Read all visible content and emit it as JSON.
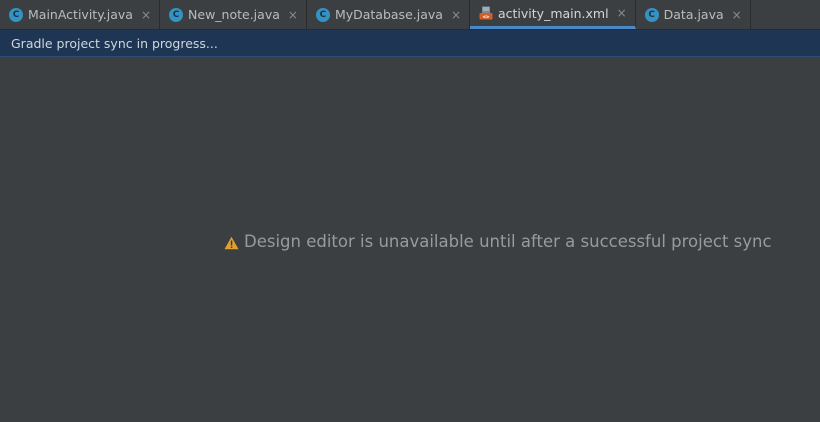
{
  "tabs": [
    {
      "label": "MainActivity.java",
      "icon": "java-class-icon",
      "active": false
    },
    {
      "label": "New_note.java",
      "icon": "java-class-icon",
      "active": false
    },
    {
      "label": "MyDatabase.java",
      "icon": "java-class-icon",
      "active": false
    },
    {
      "label": "activity_main.xml",
      "icon": "xml-layout-icon",
      "active": true
    },
    {
      "label": "Data.java",
      "icon": "java-class-icon",
      "active": false
    }
  ],
  "class_icon_letter": "C",
  "close_glyph": "×",
  "banner": {
    "text": "Gradle project sync in progress..."
  },
  "editor": {
    "message": "Design editor is unavailable until after a successful project sync",
    "message_icon": "warning-icon"
  },
  "colors": {
    "accent": "#4a88c7",
    "banner_bg": "#1e3553",
    "warning": "#e0a030",
    "java_icon": "#3592c4"
  }
}
